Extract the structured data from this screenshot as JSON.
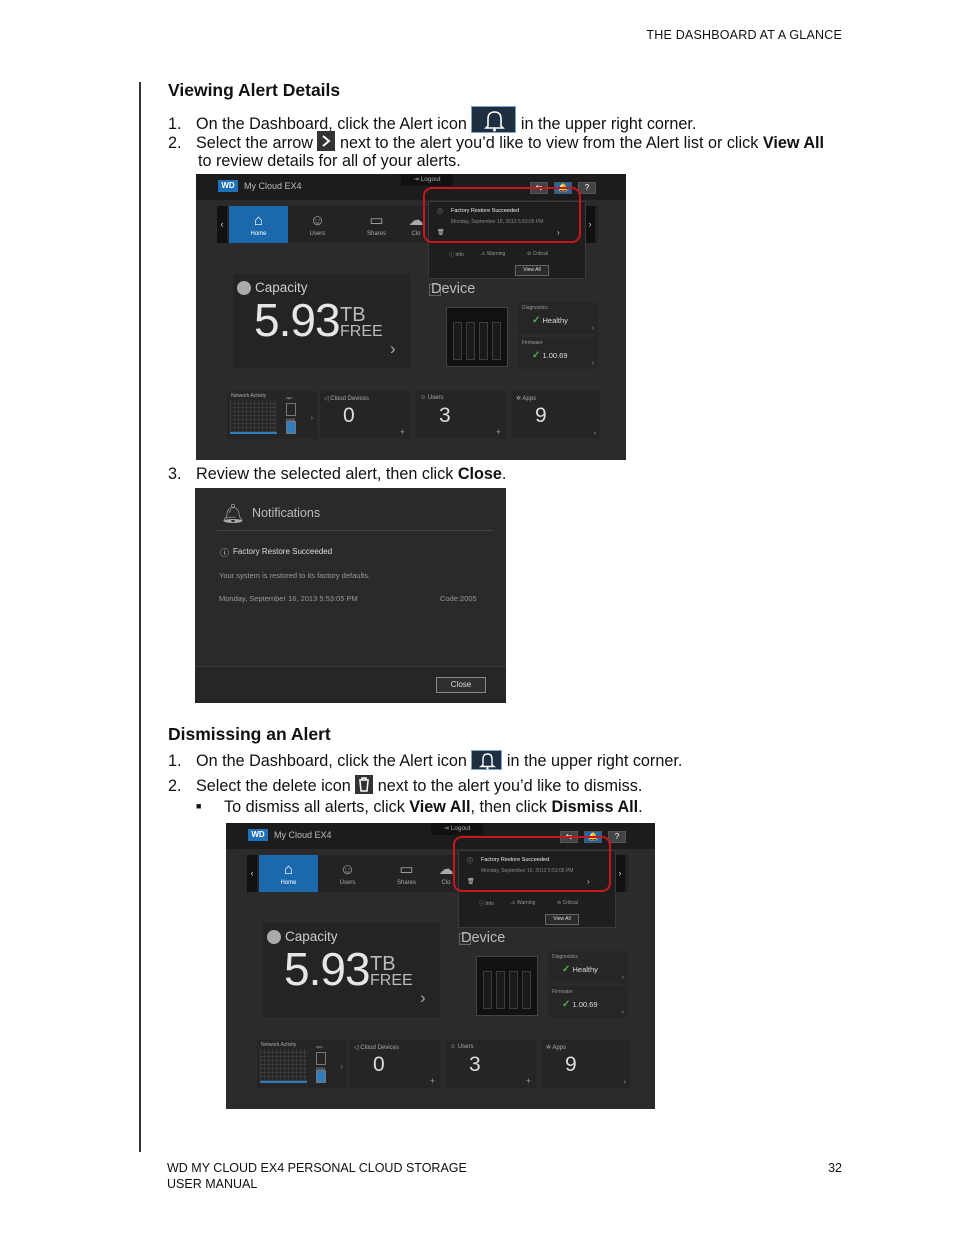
{
  "header": {
    "section": "THE DASHBOARD AT A GLANCE"
  },
  "sections": {
    "viewing": {
      "title": "Viewing Alert Details",
      "s1_num": "1.",
      "s1_pre": "On the Dashboard, click the Alert icon",
      "s1_post": "in the upper right corner.",
      "s2_num": "2.",
      "s2_pre": "Select the arrow",
      "s2_mid": "next to the alert you’d like to view from the Alert list or click",
      "s2_bold": "View All",
      "s2_cont": "to review details for all of your alerts.",
      "s3_num": "3.",
      "s3_pre": "Review the selected alert, then click",
      "s3_bold": "Close",
      "s3_post": "."
    },
    "dismissing": {
      "title": "Dismissing an Alert",
      "s1_num": "1.",
      "s1_pre": "On the Dashboard, click the Alert icon",
      "s1_post": "in the upper right corner.",
      "s2_num": "2.",
      "s2_pre": "Select the delete icon",
      "s2_post": "next to the alert you’d like to dismiss.",
      "b1_pre": "To dismiss all alerts, click",
      "b1_bold1": "View All",
      "b1_mid": ", then click",
      "b1_bold2": "Dismiss All",
      "b1_post": "."
    }
  },
  "dashboard": {
    "brand": "WD",
    "product": "My Cloud EX4",
    "logout": "Logout",
    "tabs": [
      {
        "label": "Home",
        "icon": "home-icon"
      },
      {
        "label": "Users",
        "icon": "users-icon"
      },
      {
        "label": "Shares",
        "icon": "shares-icon"
      },
      {
        "label": "Clo",
        "icon": "cloud-icon"
      }
    ],
    "toolbar": {
      "usb": "⇆",
      "alert": "🔔",
      "help": "?"
    },
    "alert_popup": {
      "title": "Factory Restore Succeeded",
      "time": "Monday, September 16, 2013 5:53:05 PM",
      "legend": [
        "Info",
        "Warning",
        "Critical"
      ],
      "view_all": "View All"
    },
    "capacity": {
      "title": "Capacity",
      "value": "5.93",
      "unit": "TB",
      "free": "FREE"
    },
    "device": {
      "title": "Device",
      "diagnostics_label": "Diagnostics",
      "diagnostics_value": "Healthy",
      "firmware_label": "Firmware",
      "firmware_value": "1.00.69"
    },
    "bottom": {
      "network": "Network Activity",
      "cpu": "cpu",
      "ram": "RAM",
      "cloud_label": "Cloud Devices",
      "cloud_value": "0",
      "users_label": "Users",
      "users_value": "3",
      "apps_label": "Apps",
      "apps_value": "9"
    }
  },
  "notifications": {
    "title": "Notifications",
    "alert_title": "Factory Restore Succeeded",
    "message": "Your system is restored to its factory defaults.",
    "date": "Monday, September 16, 2013 5:53:05 PM",
    "code": "Code:2005",
    "close": "Close"
  },
  "footer": {
    "line1": "WD MY CLOUD EX4 PERSONAL CLOUD STORAGE",
    "line2": "USER MANUAL",
    "page": "32"
  }
}
